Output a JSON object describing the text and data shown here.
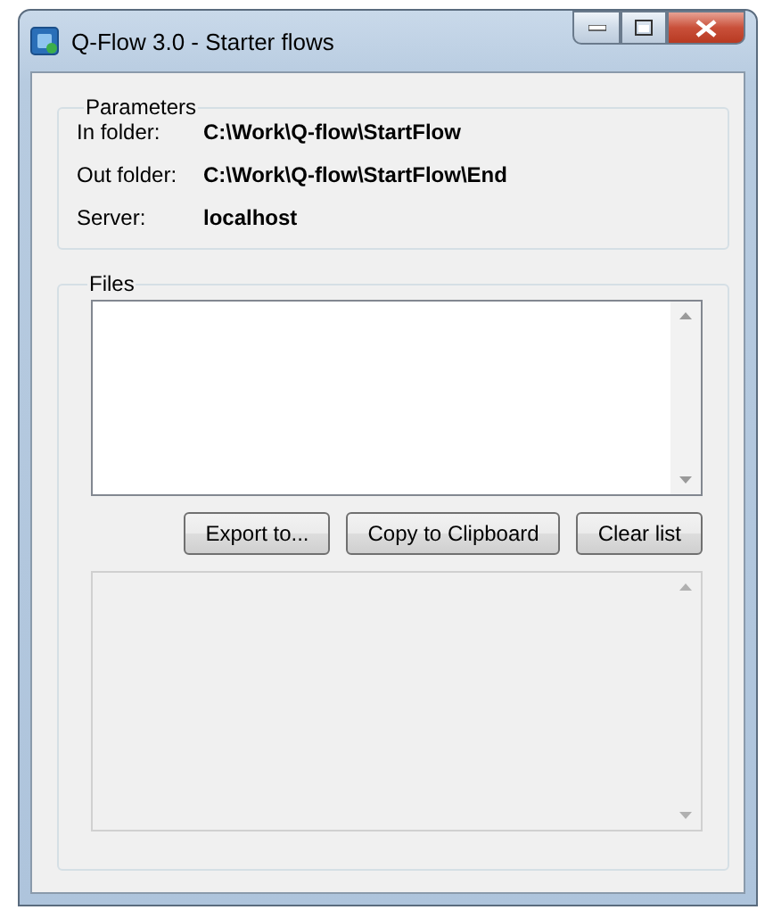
{
  "window": {
    "title": "Q-Flow 3.0 - Starter flows"
  },
  "parameters": {
    "title": "Parameters",
    "rows": [
      {
        "label": "In folder:",
        "value": "C:\\Work\\Q-flow\\StartFlow"
      },
      {
        "label": "Out folder:",
        "value": "C:\\Work\\Q-flow\\StartFlow\\End"
      },
      {
        "label": "Server:",
        "value": "localhost"
      }
    ]
  },
  "files": {
    "title": "Files",
    "list": {
      "disabled": false
    },
    "buttons": [
      "Export to...",
      "Copy to Clipboard",
      "Clear list"
    ],
    "log": {
      "disabled": true
    }
  }
}
